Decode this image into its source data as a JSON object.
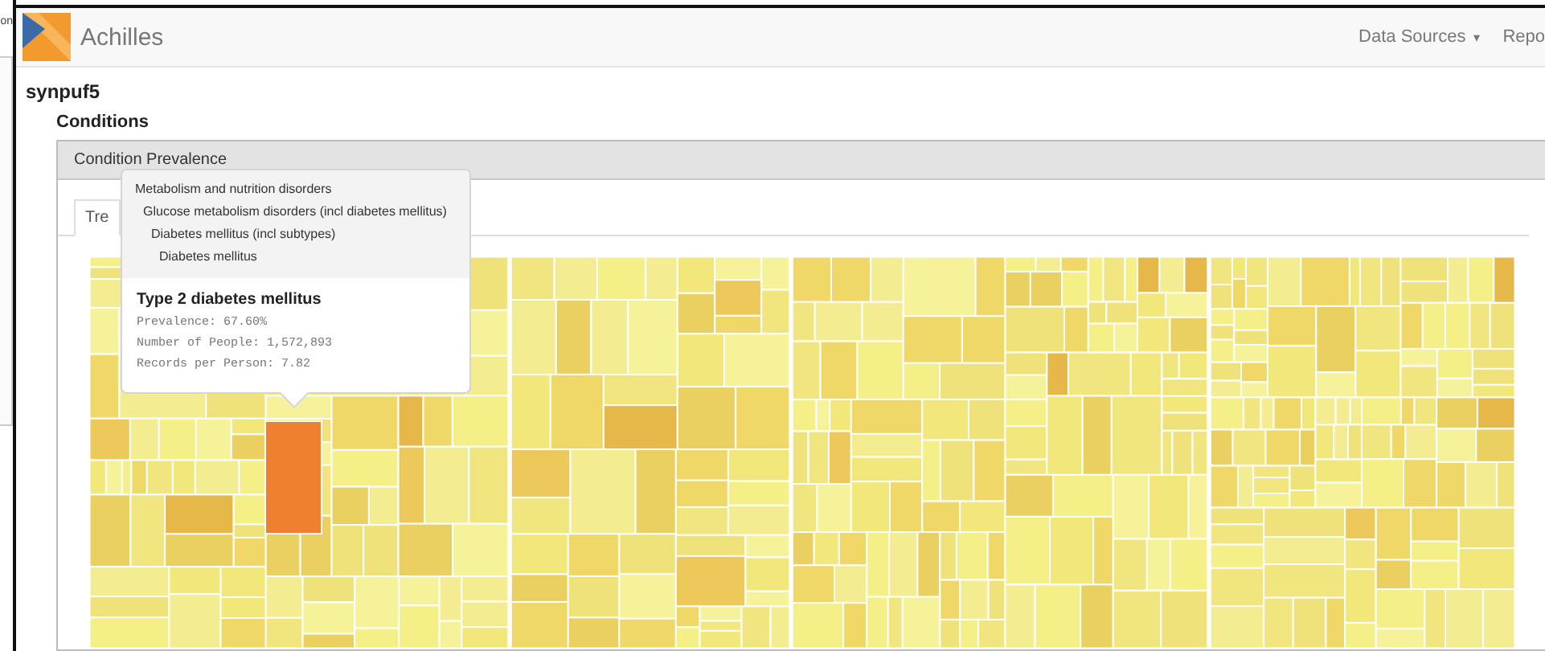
{
  "left_pane": {
    "text": "on"
  },
  "navbar": {
    "brand": "Achilles",
    "menus": [
      {
        "label": "Data Sources",
        "caret": "▾"
      },
      {
        "label": "Repo"
      }
    ]
  },
  "source": "synpuf5",
  "section": "Conditions",
  "panel": {
    "title": "Condition Prevalence",
    "tabs": [
      {
        "label": "Tre",
        "selected": true
      }
    ]
  },
  "tooltip": {
    "path": [
      {
        "name": "Metabolism and nutrition disorders",
        "children": [
          {
            "name": "Glucose metabolism disorders (incl diabetes mellitus)",
            "children": [
              {
                "name": "Diabetes mellitus (incl subtypes)",
                "children": [
                  {
                    "name": "Diabetes mellitus"
                  }
                ]
              }
            ]
          }
        ]
      }
    ],
    "title": "Type 2 diabetes mellitus",
    "lines": [
      "Prevalence: 67.60%",
      "Number of People: 1,572,893",
      "Records per Person: 7.82"
    ]
  }
}
